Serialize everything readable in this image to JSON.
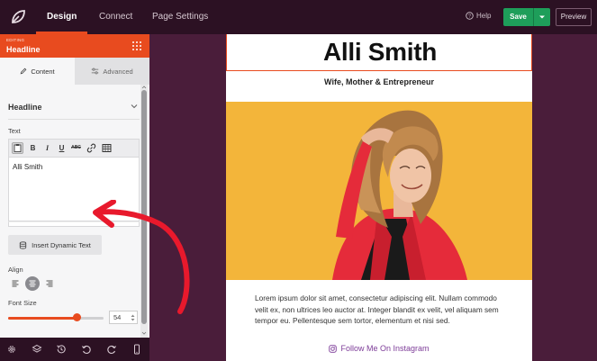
{
  "topbar": {
    "tabs": [
      {
        "label": "Design",
        "active": true
      },
      {
        "label": "Connect",
        "active": false
      },
      {
        "label": "Page Settings",
        "active": false
      }
    ],
    "help_label": "Help",
    "save_label": "Save",
    "preview_label": "Preview"
  },
  "panel": {
    "editing_label": "EDITING",
    "title": "Headline",
    "tabs": [
      {
        "label": "Content",
        "active": true
      },
      {
        "label": "Advanced",
        "active": false
      }
    ],
    "section_title": "Headline",
    "text_label": "Text",
    "editor_value": "Alli Smith",
    "dynamic_text_button": "Insert Dynamic Text",
    "align_label": "Align",
    "align_options": [
      "left",
      "center",
      "right"
    ],
    "align_selected": "center",
    "font_size_label": "Font Size",
    "font_size_value": "54",
    "font_size_fraction": 0.72
  },
  "bottom_toolbar": [
    "settings-icon",
    "layers-icon",
    "history-icon",
    "undo-icon",
    "redo-icon",
    "mobile-icon"
  ],
  "page": {
    "headline": "Alli Smith",
    "subheadline": "Wife, Mother & Entrepreneur",
    "body": "Lorem ipsum dolor sit amet, consectetur adipiscing elit. Nullam commodo velit ex, non ultrices leo auctor at. Integer blandit ex velit, vel aliquam sem tempor eu. Pellentesque sem tortor, elementum et nisi sed.",
    "instagram_link": "Follow Me On Instagram"
  },
  "colors": {
    "accent": "#e84b1f",
    "topbar": "#2c1123",
    "canvas": "#4a1d3a",
    "save_green": "#1e9e5a",
    "photo_bg": "#f3b53a",
    "link_purple": "#7d3c98",
    "annotation_red": "#e8192c"
  }
}
